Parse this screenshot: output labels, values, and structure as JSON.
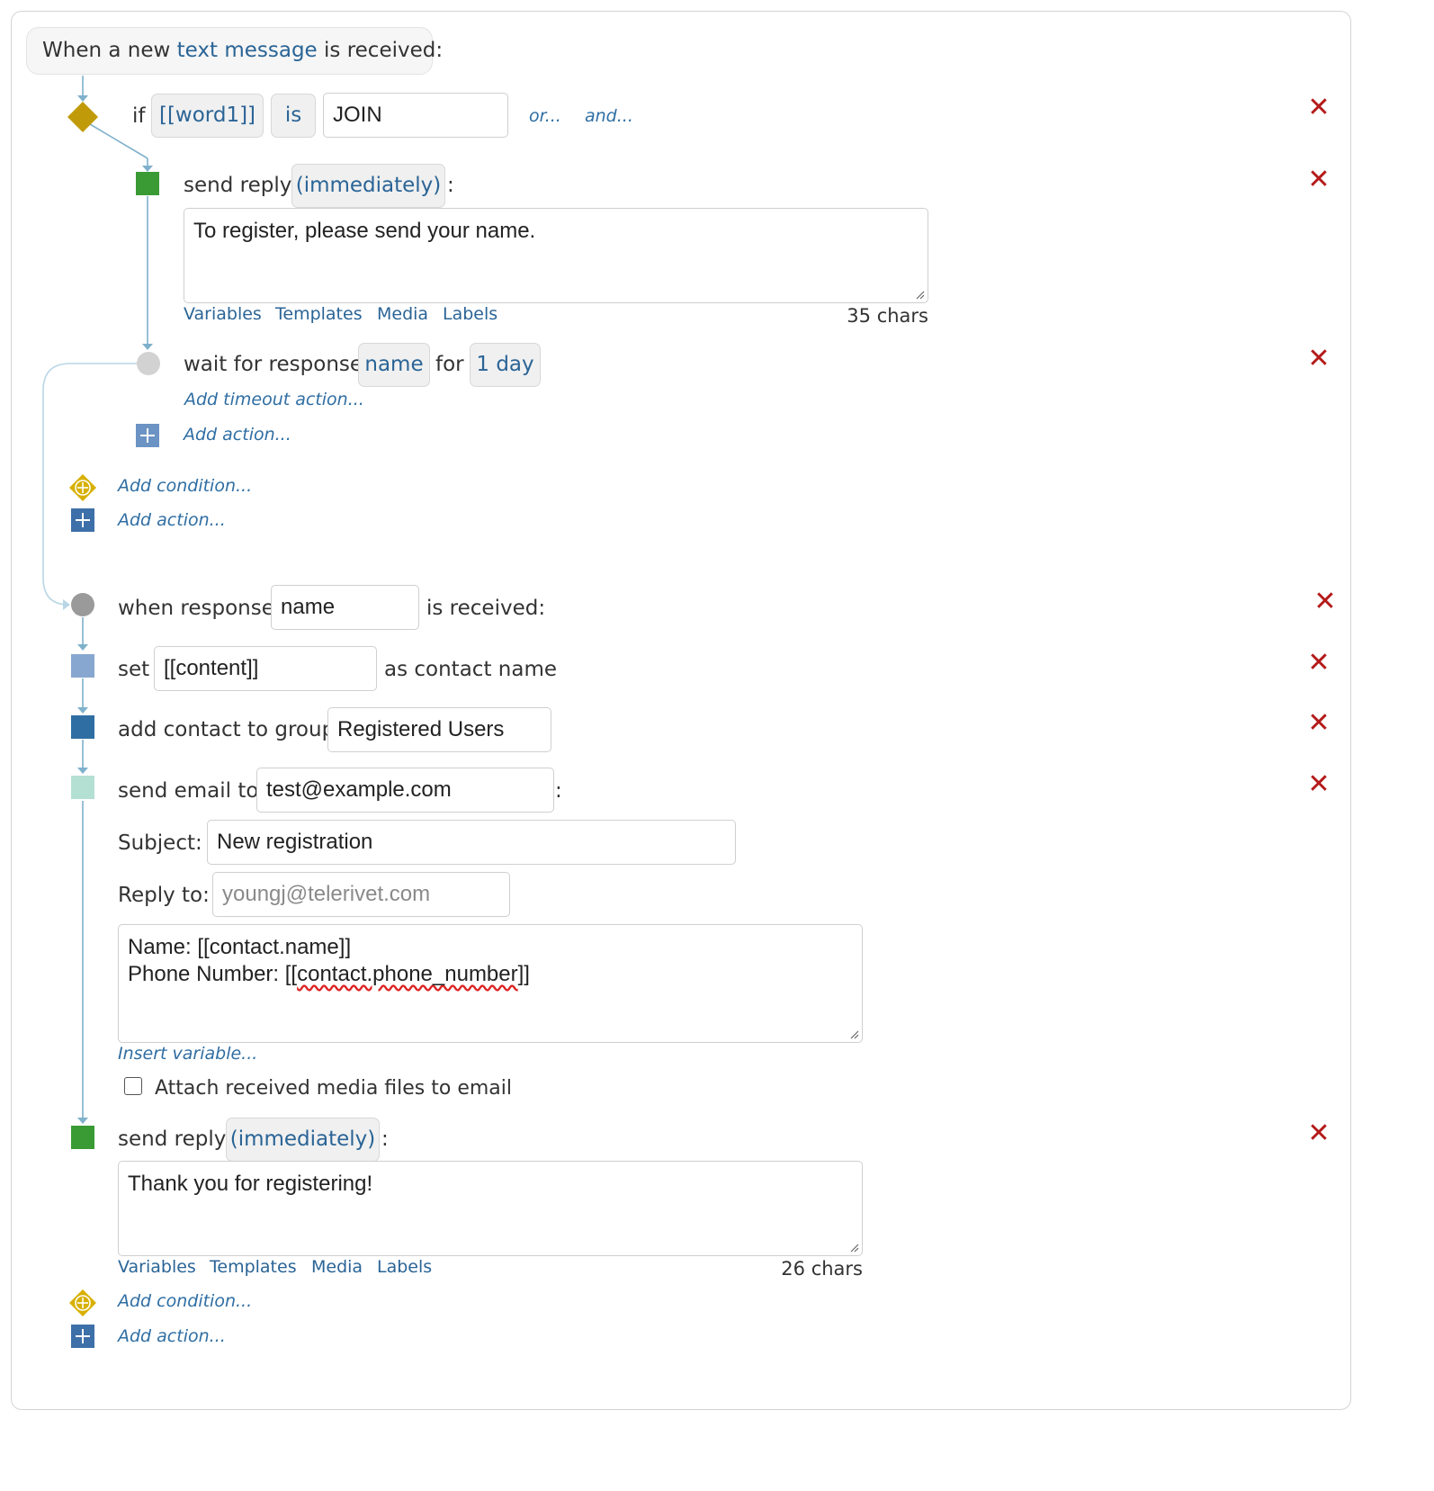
{
  "trigger": {
    "prefix": "When a new",
    "link": "text message",
    "suffix": "is received:"
  },
  "condition": {
    "if_label": "if",
    "variable": "[[word1]]",
    "operator": "is",
    "value": "JOIN",
    "or_link": "or...",
    "and_link": "and..."
  },
  "reply1": {
    "label": "send reply",
    "timing": "(immediately)",
    "colon": ":",
    "message": "To register, please send your name.",
    "links": [
      "Variables",
      "Templates",
      "Media",
      "Labels"
    ],
    "chars": "35 chars"
  },
  "wait": {
    "label": "wait for response",
    "name": "name",
    "for_label": "for",
    "duration": "1 day",
    "timeout_link": "Add timeout action..."
  },
  "inner_add_action": "Add action...",
  "add_condition": "Add condition...",
  "add_action": "Add action...",
  "response": {
    "prefix": "when response",
    "name": "name",
    "suffix": "is received:"
  },
  "set_action": {
    "prefix": "set",
    "value": "[[content]]",
    "suffix": "as contact name"
  },
  "group_action": {
    "label": "add contact to group",
    "group": "Registered Users"
  },
  "email": {
    "label": "send email to",
    "to": "test@example.com",
    "colon": ":",
    "subject_label": "Subject:",
    "subject": "New registration",
    "reply_to_label": "Reply to:",
    "reply_to_placeholder": "youngj@telerivet.com",
    "body_line1": "Name: [[contact.name]]",
    "body_line2_prefix": "Phone Number: [[",
    "body_line2_misspelled": "contact.phone_number",
    "body_line2_suffix": "]]",
    "insert_variable": "Insert variable...",
    "attach_label": "Attach received media files to email",
    "attach_checked": false
  },
  "reply2": {
    "label": "send reply",
    "timing": "(immediately)",
    "colon": ":",
    "message": "Thank you for registering!",
    "links": [
      "Variables",
      "Templates",
      "Media",
      "Labels"
    ],
    "chars": "26 chars"
  },
  "bottom_add_condition": "Add condition...",
  "bottom_add_action": "Add action...",
  "close_glyph": "✕",
  "colors": {
    "link": "#2a6496",
    "close": "#b41a1a",
    "condition_diamond": "#c09a08",
    "reply_square": "#3a9a34",
    "set_square": "#87a7d0",
    "group_square": "#2f6ea3",
    "email_square": "#b4e0d4",
    "connector": "#7fb1cc"
  },
  "icons": [
    "condition-diamond-icon",
    "reply-square-icon",
    "wait-circle-icon",
    "plus-icon",
    "add-condition-icon",
    "close-icon"
  ]
}
